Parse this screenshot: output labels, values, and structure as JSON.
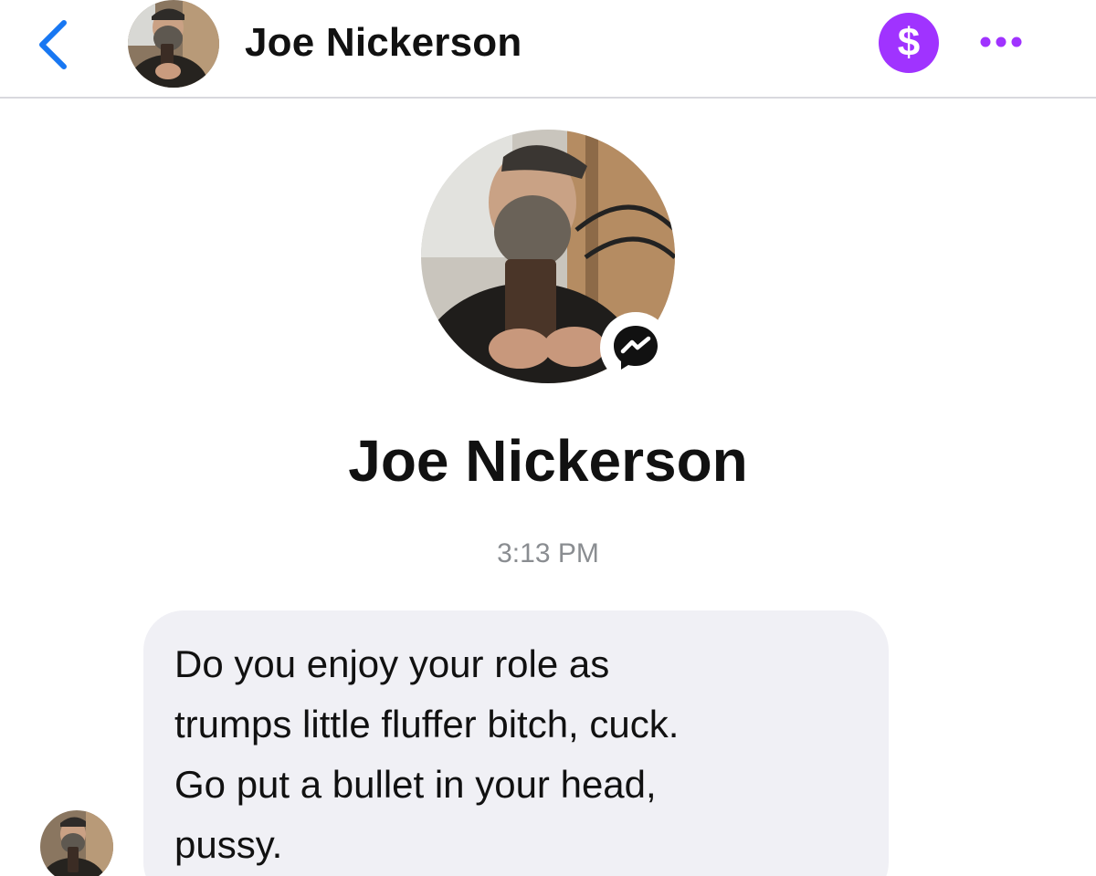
{
  "header": {
    "back_icon": "chevron-left-icon",
    "contact_name": "Joe Nickerson",
    "pay_icon": "dollar-icon",
    "pay_symbol": "$",
    "more_icon": "ellipsis-icon",
    "accent_color": "#1877f2",
    "pay_color": "#a033ff"
  },
  "profile": {
    "name": "Joe Nickerson",
    "badge_icon": "messenger-icon"
  },
  "conversation": {
    "timestamp": "3:13 PM",
    "messages": [
      {
        "direction": "incoming",
        "text": "Do you enjoy your role as\ntrumps little fluffer bitch, cuck.\nGo put a bullet in your head,\npussy."
      }
    ]
  }
}
